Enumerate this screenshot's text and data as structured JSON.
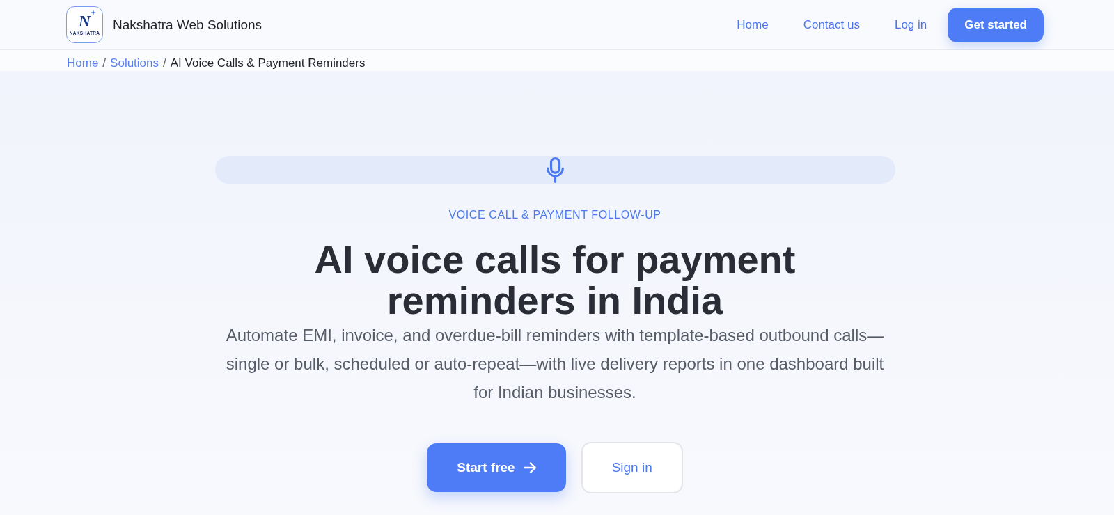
{
  "header": {
    "logo": {
      "letter": "N",
      "wordmark": "NAKSHATRA"
    },
    "brand": "Nakshatra Web Solutions",
    "nav": [
      {
        "label": "Home"
      },
      {
        "label": "Contact us"
      },
      {
        "label": "Log in"
      }
    ],
    "cta": "Get started"
  },
  "breadcrumb": {
    "separator": "/",
    "items": [
      {
        "label": "Home",
        "kind": "link"
      },
      {
        "label": "Solutions",
        "kind": "link"
      },
      {
        "label": "AI Voice Calls & Payment Reminders",
        "kind": "current"
      }
    ]
  },
  "hero": {
    "eyebrow": "VOICE CALL & PAYMENT FOLLOW-UP",
    "title": "AI voice calls for payment reminders in India",
    "description": "Automate EMI, invoice, and overdue-bill reminders with template-based outbound calls—single or bulk, scheduled or auto-repeat—with live delivery reports in one dashboard built for Indian businesses.",
    "buttons": [
      {
        "label": "Start free",
        "kind": "primary"
      },
      {
        "label": "Sign in",
        "kind": "secondary"
      }
    ]
  }
}
